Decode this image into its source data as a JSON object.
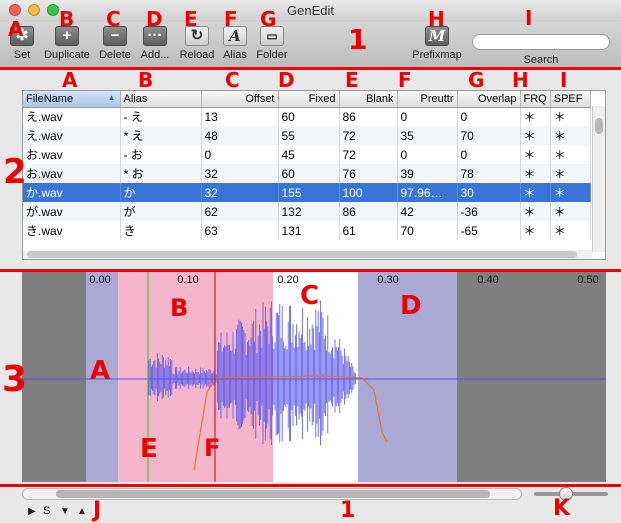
{
  "window": {
    "title": "GenEdit",
    "traffic_colors": [
      "#fc605c",
      "#fdbc40",
      "#34c749"
    ]
  },
  "toolbar": {
    "buttons": [
      {
        "label": "Set",
        "icon": "gear-icon",
        "glyph": "✱"
      },
      {
        "label": "Duplicate",
        "icon": "plus-icon",
        "glyph": "+"
      },
      {
        "label": "Delete",
        "icon": "minus-icon",
        "glyph": "−"
      },
      {
        "label": "Add...",
        "icon": "ellipsis-icon",
        "glyph": "···"
      },
      {
        "label": "Reload",
        "icon": "reload-icon",
        "glyph": "↻"
      },
      {
        "label": "Alias",
        "icon": "alias-icon",
        "glyph": "A"
      },
      {
        "label": "Folder",
        "icon": "folder-icon",
        "glyph": "▭"
      },
      {
        "label": "Prefixmap",
        "icon": "prefixmap-icon",
        "glyph": "M"
      }
    ],
    "search": {
      "label": "Search",
      "placeholder": ""
    }
  },
  "table": {
    "columns": [
      "FileName",
      "Alias",
      "Offset",
      "Fixed",
      "Blank",
      "Preuttr",
      "Overlap",
      "FRQ",
      "SPEF"
    ],
    "sorted_column": "FileName",
    "selected_row": 4,
    "rows": [
      [
        "え.wav",
        "- え",
        "13",
        "60",
        "86",
        "0",
        "0",
        "＊",
        "＊"
      ],
      [
        "え.wav",
        "* え",
        "48",
        "55",
        "72",
        "35",
        "70",
        "＊",
        "＊"
      ],
      [
        "お.wav",
        "- お",
        "0",
        "45",
        "72",
        "0",
        "0",
        "＊",
        "＊"
      ],
      [
        "お.wav",
        "* お",
        "32",
        "60",
        "76",
        "39",
        "78",
        "＊",
        "＊"
      ],
      [
        "か.wav",
        "か",
        "32",
        "155",
        "100",
        "97.96…",
        "30",
        "＊",
        "＊"
      ],
      [
        "が.wav",
        "が",
        "62",
        "132",
        "86",
        "42",
        "-36",
        "＊",
        "＊"
      ],
      [
        "き.wav",
        "き",
        "63",
        "131",
        "61",
        "70",
        "-65",
        "＊",
        "＊"
      ]
    ]
  },
  "waveform": {
    "time_ticks": [
      "0.00",
      "0.10",
      "0.20",
      "0.30",
      "0.40",
      "0.50"
    ],
    "colors": {
      "background": "#7f7f7f",
      "offset": "#a9a9d4",
      "consonant": "#f5b6cc",
      "blank": "#a9a9d4",
      "wave": "#5555ee",
      "envelope": "#e8742a",
      "preutterance": "#cc0000",
      "overlap": "#2ec62e"
    }
  },
  "statusbar": {
    "left_label": "S"
  },
  "annotations": {
    "toolbar": [
      "A",
      "B",
      "C",
      "D",
      "E",
      "F",
      "G",
      "H",
      "I"
    ],
    "toolbar_section": "1",
    "table_columns": [
      "A",
      "B",
      "C",
      "D",
      "E",
      "F",
      "G",
      "H",
      "I"
    ],
    "table_section": "2",
    "waveform": [
      "A",
      "B",
      "C",
      "D",
      "E",
      "F"
    ],
    "waveform_section": "3",
    "bottom_left": "J",
    "bottom_center": "1",
    "bottom_right": "K"
  }
}
